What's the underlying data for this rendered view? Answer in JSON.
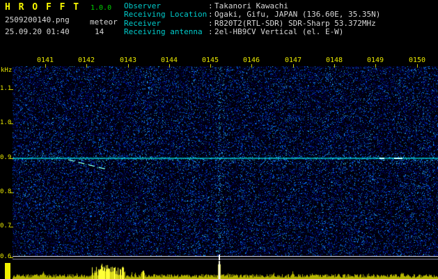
{
  "header": {
    "title": "H R O F F T",
    "version": "1.0.0",
    "filename": "2509200140.png",
    "mode": "meteor",
    "timestamp": "25.09.20 01:40",
    "count": "14",
    "info": [
      {
        "label": "Observer",
        "sep": ":",
        "value": "Takanori Kawachi"
      },
      {
        "label": "Receiving Location",
        "sep": ":",
        "value": "Ogaki, Gifu, JAPAN (136.60E, 35.35N)"
      },
      {
        "label": "Receiver",
        "sep": ":",
        "value": "R820T2(RTL-SDR) SDR-Sharp 53.372MHz"
      },
      {
        "label": "Receiving antenna",
        "sep": ":",
        "value": "2el-HB9CV Vertical (el. E-W)"
      }
    ]
  },
  "spectrogram": {
    "y_axis_unit": "kHz",
    "time_labels": [
      "0141",
      "0142",
      "0143",
      "0144",
      "0145",
      "0146",
      "0147",
      "0148",
      "0149",
      "0150"
    ],
    "freq_labels": [
      "1.1",
      "1.0",
      "0.9",
      "0.8",
      "0.7",
      "0.6"
    ],
    "signals": {
      "carrier_khz": 0.9,
      "meteor_echo": "descending doppler trace below carrier near 0142",
      "ping_time": "0145"
    },
    "colors": {
      "axis_text": "#e8e800",
      "carrier": "#00e0e0",
      "noise_speckle": "#2020ff",
      "strip_bars": "#b4b400",
      "info_label": "#00cccc",
      "info_value": "#d8d8d8"
    }
  }
}
